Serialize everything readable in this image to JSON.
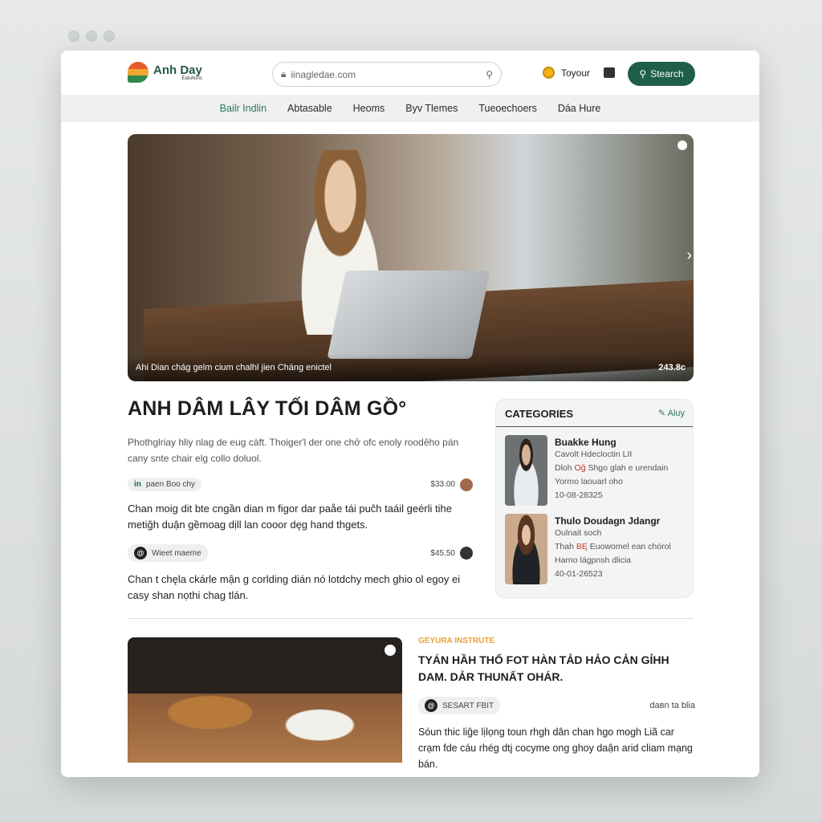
{
  "browser": {
    "controls": [
      "back",
      "forward",
      "reload"
    ]
  },
  "header": {
    "logo_title": "Anh Day",
    "logo_sub": "Eatuhuris",
    "url": "iinagledae.com",
    "tour_label": "Toyour",
    "search_button": "Stearch"
  },
  "nav": {
    "items": [
      "Bailr Indlin",
      "Abtasable",
      "Heoms",
      "Byv Tlemes",
      "Tueoechoers",
      "Dáa Hure"
    ],
    "active_index": 0
  },
  "hero": {
    "caption": "Ahi Dian chág gelm cium chalhl jien Cháng enictel",
    "counter": "243.8c"
  },
  "article": {
    "title": "ANH DÂM LÂY TỐI DÂM GỒ°",
    "lead": "Phothglriay hliy nlag de eug cáft. Thoiger'l der one chở ofc enoly roodêho pán cany sntе chair elg collo doluol.",
    "items": [
      {
        "chip_icon": "in",
        "chip": "paen Boo chy",
        "price": "$33.00",
        "body": "Chan moig dit bte cngần dian m figor dar paåe tái puĉh taáil geérli tihe metiğh duận gềmoag dịll lan cooor dęg hand thgets."
      },
      {
        "chip_icon": "@",
        "chip": "Wieet maeme",
        "price": "$45.50",
        "body": "Chan t chęla ckárle mận g corlding dián nó lotdchy mech ghio ol egoy ei casy shan nọthi chag tlán."
      }
    ]
  },
  "sidebar": {
    "title": "CATEGORIES",
    "action": "Aluy",
    "cards": [
      {
        "name": "Buakke Hung",
        "sub": "Cavolt Hdecloctin LII",
        "line_pre": "Dloh",
        "line_red": "Oğ",
        "line_post": "Shgo glah e urendain",
        "line2": "Yormo laouarl oho",
        "date": "10-08-28325"
      },
      {
        "name": "Thulo Doudagn Jdangr",
        "sub": "Oulnait soch",
        "line_pre": "Thah",
        "line_red": "BĘ",
        "line_post": "Euowomel ean chórol",
        "line2": "Harno lágpnsh dlicia",
        "date": "40-01-26523"
      }
    ]
  },
  "feature": {
    "kicker": "GEYURA INSTRUTE",
    "title": "TYÁN HẦH THỔ FOT HÀN TẢD HẢO CẢN GỈHH DAM. DẢR THUNẤT OHÁR.",
    "chip_icon": "@",
    "chip": "SESART FBIT",
    "meta_right": "dавn ta blia",
    "body": "Sóun thic liĝe lịlọng toun rhgh dân chan hgo mogh Liã car crạm fde cáu rhég dtj cocyme ong ghoy daận arid cliam mạng bán."
  },
  "colors": {
    "brand": "#1e5e4b",
    "accent_green": "#2b7a58",
    "kicker": "#e8a23a"
  }
}
